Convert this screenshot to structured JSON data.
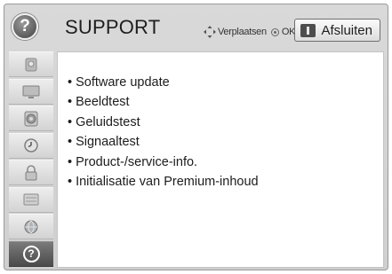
{
  "header": {
    "help_glyph": "?",
    "title": "SUPPORT",
    "nav_hint_move": "Verplaatsen",
    "nav_hint_ok": "OK",
    "exit_label": "Afsluiten"
  },
  "sidebar": {
    "items": [
      {
        "icon": "picture-settings-icon",
        "active": false
      },
      {
        "icon": "tv-screen-icon",
        "active": false
      },
      {
        "icon": "speaker-icon",
        "active": false
      },
      {
        "icon": "clock-icon",
        "active": false
      },
      {
        "icon": "lock-icon",
        "active": false
      },
      {
        "icon": "options-icon",
        "active": false
      },
      {
        "icon": "network-icon",
        "active": false
      },
      {
        "icon": "support-help-icon",
        "active": true,
        "glyph": "?"
      }
    ]
  },
  "menu": {
    "items": [
      {
        "label": "Software update"
      },
      {
        "label": "Beeldtest"
      },
      {
        "label": "Geluidstest"
      },
      {
        "label": "Signaaltest"
      },
      {
        "label": "Product-/service-info."
      },
      {
        "label": "Initialisatie van Premium-inhoud"
      }
    ]
  },
  "colors": {
    "frame_bg": "#d4d4d4",
    "active_tab": "#5a5a5a",
    "panel_bg": "#ffffff",
    "text": "#1c1c1c"
  }
}
